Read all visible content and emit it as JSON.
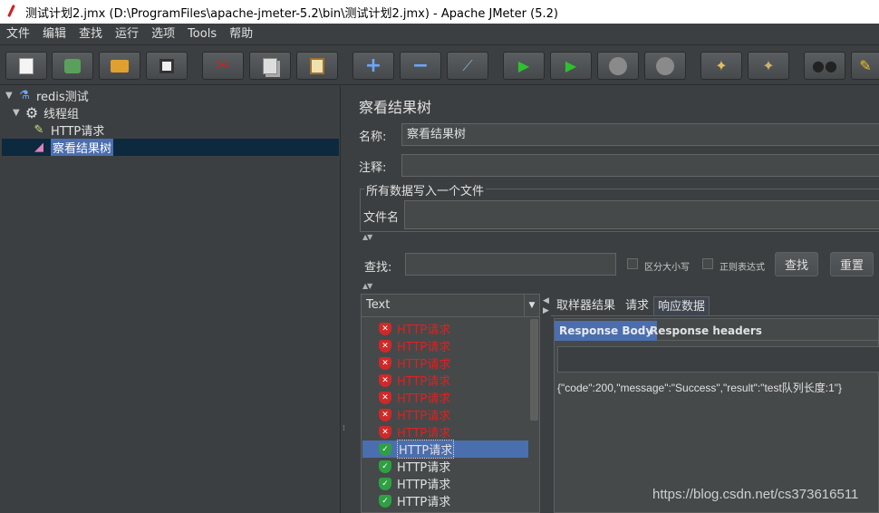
{
  "window": {
    "title": "测试计划2.jmx (D:\\ProgramFiles\\apache-jmeter-5.2\\bin\\测试计划2.jmx) - Apache JMeter (5.2)"
  },
  "menu": [
    "文件",
    "编辑",
    "查找",
    "运行",
    "选项",
    "Tools",
    "帮助"
  ],
  "toolbar": {
    "icons": [
      "new-icon",
      "templates-icon",
      "open-icon",
      "save-icon",
      "cut-icon",
      "copy-icon",
      "paste-icon",
      "expand-icon",
      "collapse-icon",
      "toggle-icon",
      "start-icon",
      "start-no-pause-icon",
      "stop-icon",
      "shutdown-icon",
      "clear-icon",
      "clear-all-icon",
      "search-icon",
      "reset-search-icon"
    ]
  },
  "tree": {
    "items": [
      {
        "label": "redis测试",
        "icon": "test-plan-icon"
      },
      {
        "label": "线程组",
        "icon": "thread-group-icon"
      },
      {
        "label": "HTTP请求",
        "icon": "sampler-icon"
      },
      {
        "label": "察看结果树",
        "icon": "listener-icon"
      }
    ]
  },
  "editor": {
    "title": "察看结果树",
    "name_label": "名称:",
    "name_value": "察看结果树",
    "comment_label": "注释:",
    "comment_value": "",
    "file_group_legend": "所有数据写入一个文件",
    "filename_label": "文件名",
    "filename_value": "",
    "search_label": "查找:",
    "search_value": "",
    "case_label": "区分大小写",
    "regex_label": "正则表达式",
    "find_button": "查找",
    "reset_button": "重置"
  },
  "results": {
    "renderer": "Text",
    "items": [
      {
        "label": "HTTP请求",
        "status": "fail"
      },
      {
        "label": "HTTP请求",
        "status": "fail"
      },
      {
        "label": "HTTP请求",
        "status": "fail"
      },
      {
        "label": "HTTP请求",
        "status": "fail"
      },
      {
        "label": "HTTP请求",
        "status": "fail"
      },
      {
        "label": "HTTP请求",
        "status": "fail"
      },
      {
        "label": "HTTP请求",
        "status": "fail"
      },
      {
        "label": "HTTP请求",
        "status": "ok"
      },
      {
        "label": "HTTP请求",
        "status": "ok"
      },
      {
        "label": "HTTP请求",
        "status": "ok"
      },
      {
        "label": "HTTP请求",
        "status": "ok"
      }
    ]
  },
  "detail": {
    "tabs": [
      "取样器结果",
      "请求",
      "响应数据"
    ],
    "subtabs": [
      "Response Body",
      "Response headers"
    ],
    "response_body": "{\"code\":200,\"message\":\"Success\",\"result\":\"test队列长度:1\"}"
  },
  "watermark": "https://blog.csdn.net/cs373616511",
  "colors": {
    "background": "#3c3f41",
    "selection": "#4b6eaf",
    "fail": "#e02020",
    "success": "#2ea043"
  }
}
